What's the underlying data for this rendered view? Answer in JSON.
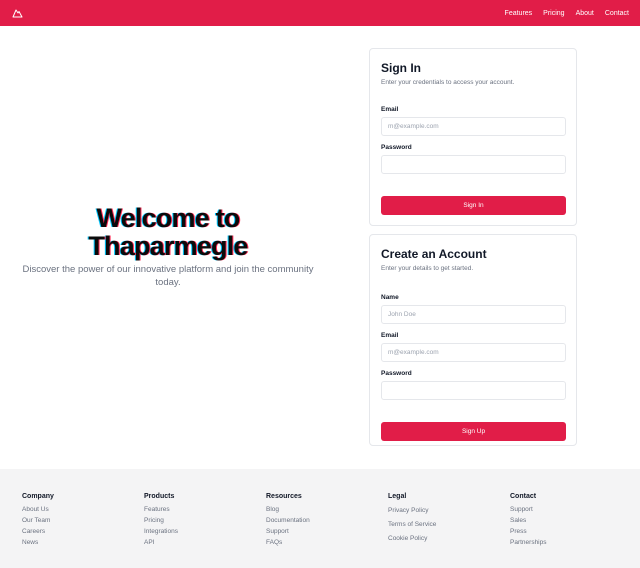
{
  "nav": {
    "links": [
      "Features",
      "Pricing",
      "About",
      "Contact"
    ],
    "brand_color": "#e11d48"
  },
  "hero": {
    "title_line1": "Welcome to",
    "title_line2": "Thaparmegle",
    "subtitle": "Discover the power of our innovative platform and join the community today."
  },
  "signin": {
    "title": "Sign In",
    "description": "Enter your credentials to access your account.",
    "email_label": "Email",
    "email_placeholder": "m@example.com",
    "password_label": "Password",
    "button_label": "Sign In"
  },
  "signup": {
    "title": "Create an Account",
    "description": "Enter your details to get started.",
    "name_label": "Name",
    "name_placeholder": "John Doe",
    "email_label": "Email",
    "email_placeholder": "m@example.com",
    "password_label": "Password",
    "button_label": "Sign Up"
  },
  "footer": {
    "columns": [
      {
        "heading": "Company",
        "links": [
          "About Us",
          "Our Team",
          "Careers",
          "News"
        ]
      },
      {
        "heading": "Products",
        "links": [
          "Features",
          "Pricing",
          "Integrations",
          "API"
        ]
      },
      {
        "heading": "Resources",
        "links": [
          "Blog",
          "Documentation",
          "Support",
          "FAQs"
        ]
      },
      {
        "heading": "Legal",
        "links": [
          "Privacy Policy",
          "Terms of Service",
          "Cookie Policy"
        ]
      },
      {
        "heading": "Contact",
        "links": [
          "Support",
          "Sales",
          "Press",
          "Partnerships"
        ]
      }
    ]
  }
}
